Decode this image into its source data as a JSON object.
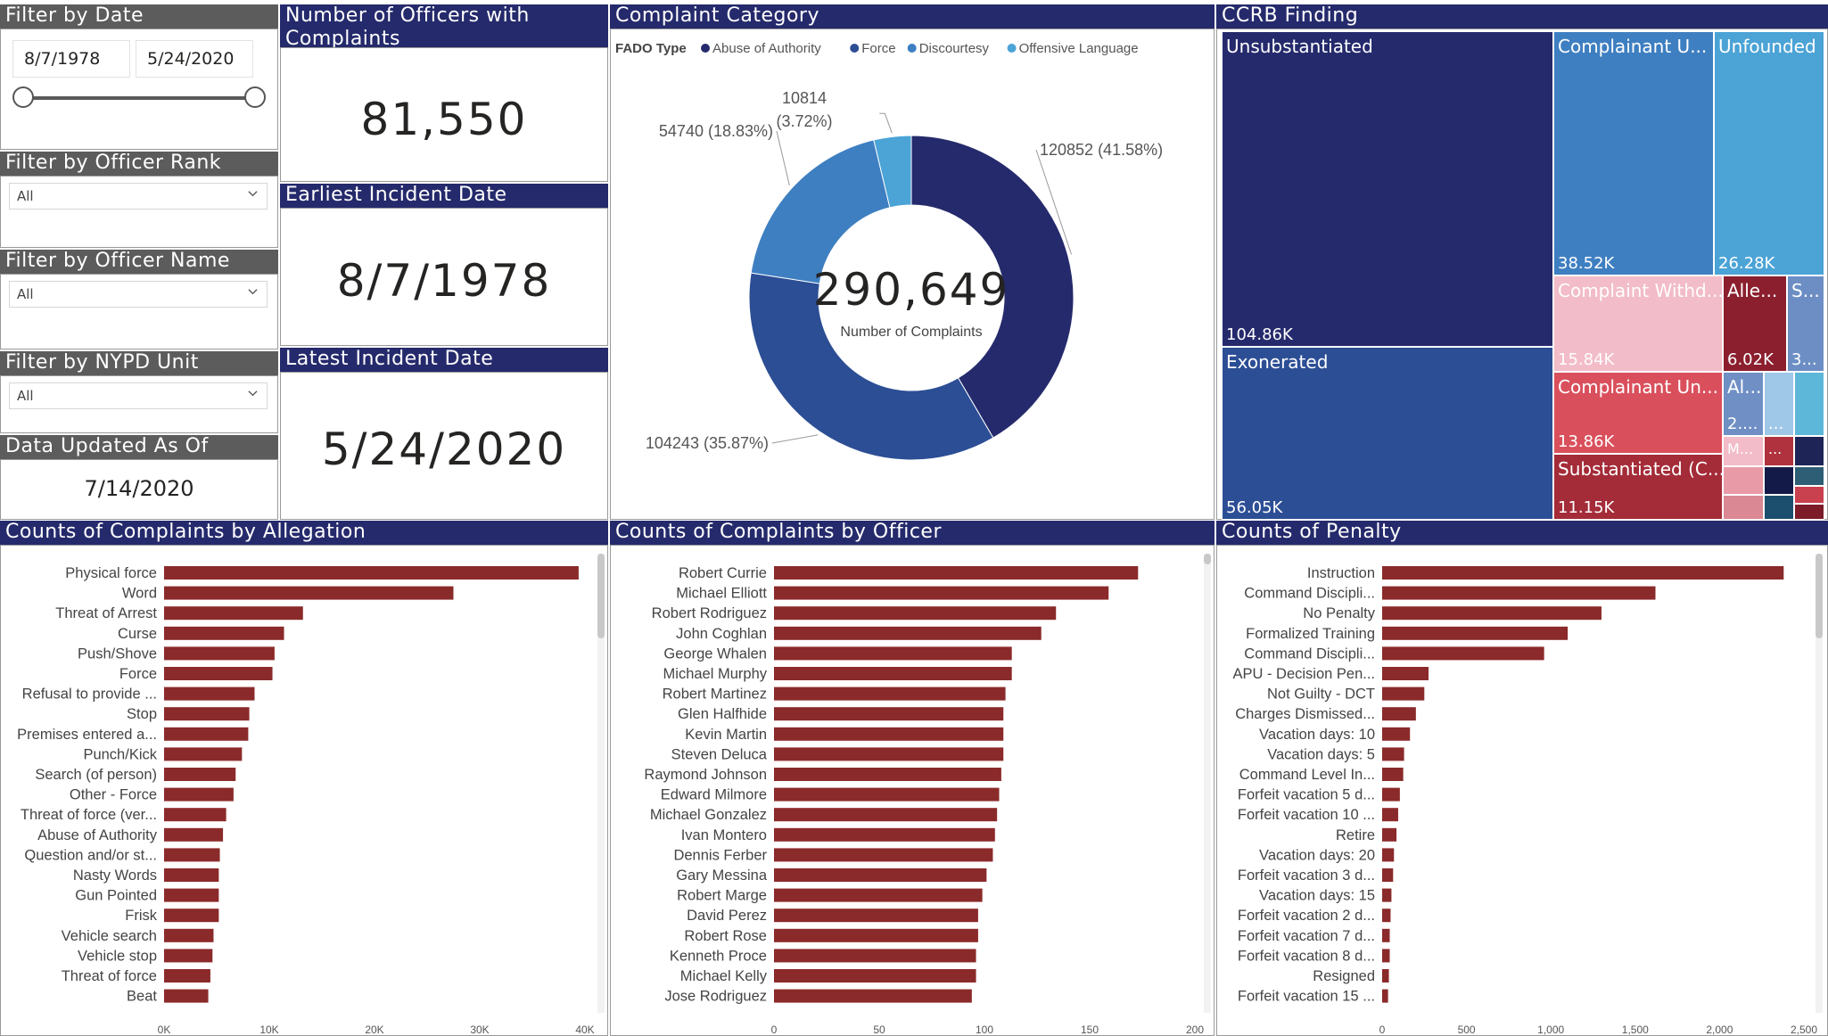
{
  "filters": {
    "date": {
      "title": "Filter by Date",
      "start": "8/7/1978",
      "end": "5/24/2020"
    },
    "rank": {
      "title": "Filter by Officer Rank",
      "value": "All"
    },
    "name": {
      "title": "Filter by Officer Name",
      "value": "All"
    },
    "unit": {
      "title": "Filter by NYPD Unit",
      "value": "All"
    },
    "updated": {
      "title": "Data Updated As Of",
      "value": "7/14/2020"
    }
  },
  "cards": {
    "officers": {
      "title": "Number of Officers with Complaints",
      "value": "81,550"
    },
    "earliest": {
      "title": "Earliest Incident Date",
      "value": "8/7/1978"
    },
    "latest": {
      "title": "Latest Incident Date",
      "value": "5/24/2020"
    }
  },
  "complaint_category": {
    "title": "Complaint Category",
    "legend_title": "FADO Type",
    "center_value": "290,649",
    "center_label": "Number of Complaints"
  },
  "ccrb": {
    "title": "CCRB Finding",
    "tiles": [
      {
        "label": "Unsubstantiated",
        "value": "104.86K",
        "color": "#252A6C"
      },
      {
        "label": "Exonerated",
        "value": "56.05K",
        "color": "#2C4E95"
      },
      {
        "label": "Complainant U...",
        "value": "38.52K",
        "color": "#3E7FC1"
      },
      {
        "label": "Unfounded",
        "value": "26.28K",
        "color": "#4BA3D6"
      },
      {
        "label": "Complaint Withd...",
        "value": "15.84K",
        "color": "#F2BCC8"
      },
      {
        "label": "Alle...",
        "value": "6.02K",
        "color": "#8B1F2E"
      },
      {
        "label": "S...",
        "value": "3...",
        "color": "#6C8EC4"
      },
      {
        "label": "Complainant Un...",
        "value": "13.86K",
        "color": "#D9505C"
      },
      {
        "label": "Substantiated (C...",
        "value": "11.15K",
        "color": "#A42B38"
      },
      {
        "label": "Al...",
        "value": "2....",
        "color": "#6F8FC5"
      },
      {
        "label": "...",
        "value": "",
        "color": "#9FC7E8"
      },
      {
        "label": "...",
        "value": "",
        "color": "#5DB7D9"
      },
      {
        "label": "M...",
        "value": "",
        "color": "#F2BCC8"
      },
      {
        "label": "...",
        "value": "",
        "color": "#B0323E"
      }
    ]
  },
  "allegation": {
    "title": "Counts of Complaints by Allegation"
  },
  "officer": {
    "title": "Counts of Complaints by Officer"
  },
  "penalty": {
    "title": "Counts of Penalty"
  },
  "chart_data": [
    {
      "type": "pie",
      "title": "Complaint Category",
      "legend_title": "FADO Type",
      "legend_position": "top-left",
      "categories": [
        "Abuse of Authority",
        "Force",
        "Discourtesy",
        "Offensive Language"
      ],
      "values": [
        120852,
        104243,
        54740,
        10814
      ],
      "labels": [
        "120852 (41.58%)",
        "104243 (35.87%)",
        "54740 (18.83%)",
        "10814 (3.72%)"
      ],
      "colors": [
        "#252A6C",
        "#2C4E95",
        "#3E7FC1",
        "#4BA3D6"
      ]
    },
    {
      "type": "bar",
      "orientation": "horizontal",
      "title": "Counts of Complaints by Allegation",
      "categories": [
        "Physical force",
        "Word",
        "Threat of Arrest",
        "Curse",
        "Push/Shove",
        "Force",
        "Refusal to provide ...",
        "Stop",
        "Premises entered a...",
        "Punch/Kick",
        "Search (of person)",
        "Other - Force",
        "Threat of force (ver...",
        "Abuse of Authority",
        "Question and/or st...",
        "Nasty Words",
        "Gun Pointed",
        "Frisk",
        "Vehicle search",
        "Vehicle stop",
        "Threat of force",
        "Beat"
      ],
      "values": [
        39400,
        27500,
        13200,
        11400,
        10500,
        10300,
        8600,
        8100,
        8000,
        7400,
        6800,
        6600,
        5900,
        5600,
        5300,
        5200,
        5200,
        5200,
        4700,
        4600,
        4400,
        4200
      ],
      "xlim": [
        0,
        40000
      ],
      "ticks": [
        "0K",
        "10K",
        "20K",
        "30K",
        "40K"
      ],
      "color": "#8B2A2A",
      "grid": false
    },
    {
      "type": "bar",
      "orientation": "horizontal",
      "title": "Counts of Complaints by Officer",
      "categories": [
        "Robert Currie",
        "Michael Elliott",
        "Robert Rodriguez",
        "John Coghlan",
        "George Whalen",
        "Michael Murphy",
        "Robert Martinez",
        "Glen Halfhide",
        "Kevin Martin",
        "Steven Deluca",
        "Raymond Johnson",
        "Edward Milmore",
        "Michael Gonzalez",
        "Ivan Montero",
        "Dennis Ferber",
        "Gary Messina",
        "Robert Marge",
        "David Perez",
        "Robert Rose",
        "Kenneth Proce",
        "Michael Kelly",
        "Jose Rodriguez"
      ],
      "values": [
        173,
        159,
        134,
        127,
        113,
        113,
        110,
        109,
        109,
        109,
        108,
        107,
        106,
        105,
        104,
        101,
        99,
        97,
        97,
        96,
        96,
        94
      ],
      "xlim": [
        0,
        200
      ],
      "ticks": [
        "0",
        "50",
        "100",
        "150",
        "200"
      ],
      "color": "#8B2A2A",
      "grid": false
    },
    {
      "type": "bar",
      "orientation": "horizontal",
      "title": "Counts of Penalty",
      "categories": [
        "Instruction",
        "Command Discipli...",
        "No Penalty",
        "Formalized Training",
        "Command Discipli...",
        "APU - Decision Pen...",
        "Not Guilty - DCT",
        "Charges Dismissed...",
        "Vacation days: 10",
        "Vacation days: 5",
        "Command Level In...",
        "Forfeit vacation 5 d...",
        "Forfeit vacation 10 ...",
        "Retire",
        "Vacation days: 20",
        "Forfeit vacation 3 d...",
        "Vacation days: 15",
        "Forfeit vacation 2 d...",
        "Forfeit vacation 7 d...",
        "Forfeit vacation 8 d...",
        "Resigned",
        "Forfeit vacation 15 ..."
      ],
      "values": [
        2380,
        1620,
        1300,
        1100,
        960,
        275,
        250,
        200,
        165,
        130,
        125,
        105,
        95,
        85,
        70,
        65,
        55,
        50,
        45,
        45,
        40,
        35
      ],
      "xlim": [
        0,
        2500
      ],
      "ticks": [
        "0",
        "500",
        "1,000",
        "1,500",
        "2,000",
        "2,500"
      ],
      "color": "#8B2A2A",
      "grid": false
    }
  ]
}
